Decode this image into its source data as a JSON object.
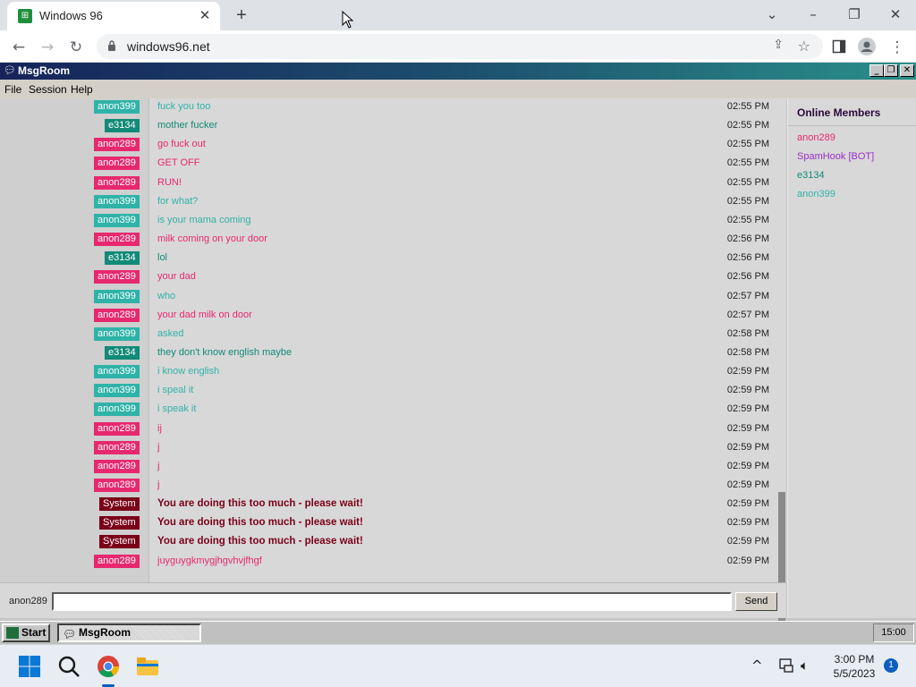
{
  "browser": {
    "tab_title": "Windows 96",
    "url": "windows96.net"
  },
  "app": {
    "title": "MsgRoom",
    "menu": [
      "File",
      "Session",
      "Help"
    ]
  },
  "colors": {
    "anon289": "#e8286e",
    "anon399": "#2fb3a8",
    "e3134": "#118a77",
    "System": "#7a0018",
    "SpamHook [BOT]": "#9a2ec8"
  },
  "messages": [
    {
      "time": "02:55 PM",
      "nick": "anon399",
      "text": "fuck you too"
    },
    {
      "time": "02:55 PM",
      "nick": "e3134",
      "text": "mother fucker"
    },
    {
      "time": "02:55 PM",
      "nick": "anon289",
      "text": "go fuck out"
    },
    {
      "time": "02:55 PM",
      "nick": "anon289",
      "text": "GET OFF"
    },
    {
      "time": "02:55 PM",
      "nick": "anon289",
      "text": "RUN!"
    },
    {
      "time": "02:55 PM",
      "nick": "anon399",
      "text": "for what?"
    },
    {
      "time": "02:55 PM",
      "nick": "anon399",
      "text": "is your mama coming"
    },
    {
      "time": "02:56 PM",
      "nick": "anon289",
      "text": "milk coming on your door"
    },
    {
      "time": "02:56 PM",
      "nick": "e3134",
      "text": "lol"
    },
    {
      "time": "02:56 PM",
      "nick": "anon289",
      "text": "your dad"
    },
    {
      "time": "02:57 PM",
      "nick": "anon399",
      "text": "who"
    },
    {
      "time": "02:57 PM",
      "nick": "anon289",
      "text": "your dad milk on door"
    },
    {
      "time": "02:58 PM",
      "nick": "anon399",
      "text": "asked"
    },
    {
      "time": "02:58 PM",
      "nick": "e3134",
      "text": "they don't know english maybe"
    },
    {
      "time": "02:59 PM",
      "nick": "anon399",
      "text": "i know english"
    },
    {
      "time": "02:59 PM",
      "nick": "anon399",
      "text": "i speal it"
    },
    {
      "time": "02:59 PM",
      "nick": "anon399",
      "text": "i speak it"
    },
    {
      "time": "02:59 PM",
      "nick": "anon289",
      "text": "ij"
    },
    {
      "time": "02:59 PM",
      "nick": "anon289",
      "text": "j"
    },
    {
      "time": "02:59 PM",
      "nick": "anon289",
      "text": "j"
    },
    {
      "time": "02:59 PM",
      "nick": "anon289",
      "text": "j"
    },
    {
      "time": "02:59 PM",
      "nick": "System",
      "text": "You are doing this too much - please wait!"
    },
    {
      "time": "02:59 PM",
      "nick": "System",
      "text": "You are doing this too much - please wait!"
    },
    {
      "time": "02:59 PM",
      "nick": "System",
      "text": "You are doing this too much - please wait!"
    },
    {
      "time": "02:59 PM",
      "nick": "anon289",
      "text": "juyguygkmygjhgvhvjfhgf"
    }
  ],
  "members": {
    "heading": "Online Members",
    "list": [
      "anon289",
      "SpamHook [BOT]",
      "e3134",
      "anon399"
    ]
  },
  "input": {
    "username": "anon289",
    "value": "",
    "send_label": "Send"
  },
  "w96_taskbar": {
    "start_label": "Start",
    "task_label": "MsgRoom",
    "clock": "15:00"
  },
  "windows": {
    "time": "3:00 PM",
    "date": "5/5/2023",
    "notifications": "1"
  }
}
